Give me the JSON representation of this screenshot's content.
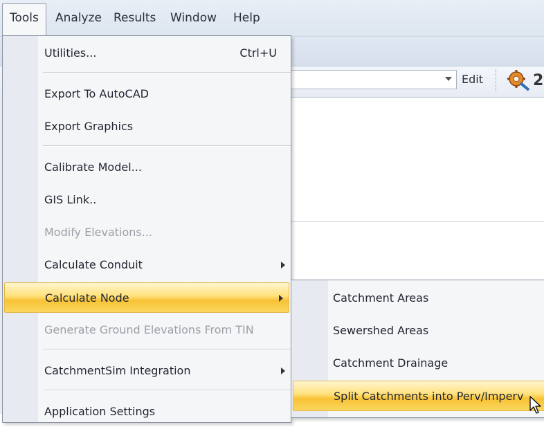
{
  "menubar": {
    "items": [
      {
        "label": "Tools"
      },
      {
        "label": "Analyze"
      },
      {
        "label": "Results"
      },
      {
        "label": "Window"
      },
      {
        "label": "Help"
      }
    ]
  },
  "toolbar": {
    "edit_label": "Edit",
    "tool_digit": "2"
  },
  "tools_menu": {
    "items": [
      {
        "label": "Utilities...",
        "shortcut": "Ctrl+U"
      },
      {
        "label": "Export To AutoCAD"
      },
      {
        "label": "Export Graphics"
      },
      {
        "label": "Calibrate Model..."
      },
      {
        "label": "GIS Link.."
      },
      {
        "label": "Modify Elevations...",
        "disabled": true
      },
      {
        "label": "Calculate Conduit",
        "submenu": true
      },
      {
        "label": "Calculate Node",
        "submenu": true,
        "highlighted": true
      },
      {
        "label": "Generate Ground Elevations From TIN",
        "disabled": true
      },
      {
        "label": "CatchmentSim Integration",
        "submenu": true
      },
      {
        "label": "Application Settings"
      }
    ]
  },
  "calculate_node_submenu": {
    "items": [
      {
        "label": "Catchment Areas"
      },
      {
        "label": "Sewershed Areas"
      },
      {
        "label": "Catchment Drainage"
      },
      {
        "label": "Split Catchments into Perv/Imperv",
        "highlighted": true
      }
    ]
  },
  "colors": {
    "highlight": "#f7c235",
    "menu_bg": "#f5f6f7",
    "gutter": "#e7ebf1",
    "disabled_text": "#9aa0a8"
  }
}
